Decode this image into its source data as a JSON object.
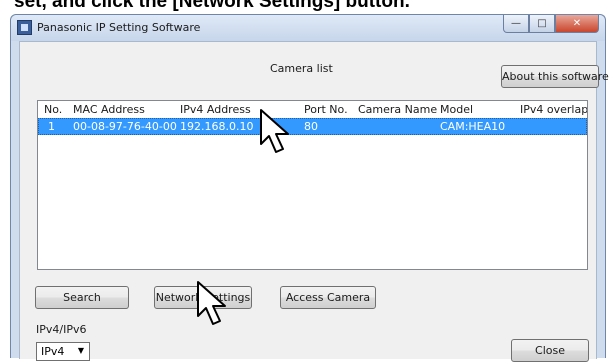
{
  "doc": {
    "heading": "set, and click the [Network Settings] button."
  },
  "window": {
    "title": "Panasonic IP Setting Software",
    "min_glyph": "—",
    "max_glyph": "□",
    "close_glyph": "✕"
  },
  "camera_list": {
    "title": "Camera list",
    "columns": [
      "No.",
      "MAC Address",
      "IPv4 Address",
      "Port No.",
      "Camera Name",
      "Model",
      "IPv4 overlap"
    ],
    "rows": [
      {
        "no": "1",
        "mac": "00-08-97-76-40-00",
        "ipv4": "192.168.0.10",
        "port": "80",
        "name": "",
        "model": "CAM:HEA10",
        "overlap": ""
      }
    ]
  },
  "buttons": {
    "about": "About this software",
    "search": "Search",
    "network_settings": "Network Settings",
    "access_camera": "Access Camera",
    "close": "Close"
  },
  "ip_mode": {
    "label": "IPv4/IPv6",
    "selected": "IPv4"
  },
  "icons": {
    "dropdown": "chevron-down-icon",
    "cursor": "mouse-pointer-icon",
    "app": "app-icon"
  }
}
